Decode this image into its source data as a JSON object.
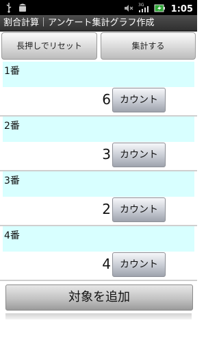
{
  "status_bar": {
    "time": "1:05",
    "network_label": "3G",
    "icons": [
      "usb-icon",
      "android-debug-icon",
      "mute-icon",
      "signal-icon",
      "battery-icon"
    ]
  },
  "app": {
    "title": "割合計算｜アンケート集計グラフ作成"
  },
  "toolbar": {
    "reset_label": "長押しでリセット",
    "total_label": "集計する"
  },
  "items": [
    {
      "label": "1番",
      "count": "6",
      "button": "カウント"
    },
    {
      "label": "2番",
      "count": "3",
      "button": "カウント"
    },
    {
      "label": "3番",
      "count": "2",
      "button": "カウント"
    },
    {
      "label": "4番",
      "count": "4",
      "button": "カウント"
    }
  ],
  "add_button_label": "対象を追加",
  "colors": {
    "item_header_bg": "#d8ffff",
    "title_bar_bg": "#3a3a3a"
  }
}
